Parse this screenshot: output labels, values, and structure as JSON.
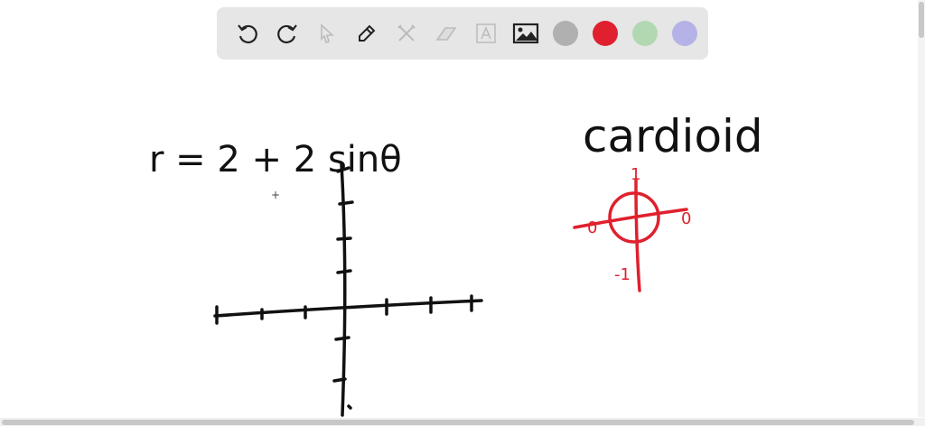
{
  "toolbar": {
    "tools": [
      "undo",
      "redo",
      "select",
      "pen",
      "tools",
      "eraser",
      "text",
      "image"
    ],
    "colors": [
      "#b0b0b0",
      "#e0202e",
      "#b2d8b2",
      "#b4b2e6"
    ]
  },
  "board": {
    "equation": "r = 2 + 2 sinθ",
    "title": "cardioid",
    "sketch_labels": {
      "top": "1",
      "left": "0",
      "right": "0",
      "bottom": "-1"
    }
  }
}
